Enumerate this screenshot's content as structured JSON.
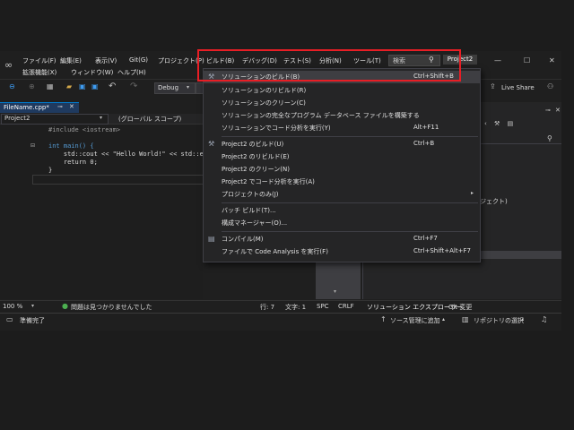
{
  "menubar": {
    "row1": [
      "ファイル(F)",
      "編集(E)",
      "表示(V)",
      "Git(G)",
      "プロジェクト(P)",
      "ビルド(B)",
      "デバッグ(D)",
      "テスト(S)",
      "分析(N)",
      "ツール(T)"
    ],
    "row2": [
      "拡張機能(X)",
      "ウィンドウ(W)",
      "ヘルプ(H)"
    ],
    "search_label": "検索",
    "project_badge": "Project2"
  },
  "window_controls": {
    "minimize": "—",
    "maximize": "☐",
    "close": "✕"
  },
  "toolbar": {
    "config": "Debug",
    "live_share": "Live Share"
  },
  "editor": {
    "tab": "FileName.cpp*",
    "project_combo": "Project2",
    "scope_combo": "(グローバル スコープ)",
    "lines": [
      "#include <iostream>",
      "",
      "int main() {",
      "    std::cout << \"Hello World!\" << std::endl;",
      "    return 0;",
      "}"
    ],
    "zoom": "100 %",
    "issues": "問題は見つかりませんでした",
    "position": "行: 7",
    "char": "文字: 1",
    "spc": "SPC",
    "crlf": "CRLF"
  },
  "solution_panel": {
    "item": "ジェクト)",
    "tab_solution": "ソリューション エクスプローラー",
    "tab_git": "Git 変更"
  },
  "dropdown": {
    "items": [
      {
        "label": "ソリューションのビルド(B)",
        "shortcut": "Ctrl+Shift+B",
        "icon": "build-icon"
      },
      {
        "label": "ソリューションのリビルド(R)",
        "shortcut": ""
      },
      {
        "label": "ソリューションのクリーン(C)",
        "shortcut": ""
      },
      {
        "label": "ソリューションの完全なプログラム データベース ファイルを構築する",
        "shortcut": ""
      },
      {
        "label": "ソリューションでコード分析を実行(Y)",
        "shortcut": "Alt+F11"
      },
      {
        "label": "Project2 のビルド(U)",
        "shortcut": "Ctrl+B",
        "icon": "project-build-icon"
      },
      {
        "label": "Project2 のリビルド(E)",
        "shortcut": ""
      },
      {
        "label": "Project2 のクリーン(N)",
        "shortcut": ""
      },
      {
        "label": "Project2 でコード分析を実行(A)",
        "shortcut": ""
      },
      {
        "label": "プロジェクトのみ(J)",
        "shortcut": "",
        "submenu": "▸"
      },
      {
        "label": "バッチ ビルド(T)...",
        "shortcut": ""
      },
      {
        "label": "構成マネージャー(O)...",
        "shortcut": ""
      },
      {
        "label": "コンパイル(M)",
        "shortcut": "Ctrl+F7",
        "icon": "compile-icon"
      },
      {
        "label": "ファイルで Code Analysis を実行(F)",
        "shortcut": "Ctrl+Shift+Alt+F7"
      }
    ]
  },
  "statusbar": {
    "ready": "準備完了",
    "source_control": "ソース管理に追加",
    "repo_select": "リポジトリの選択"
  },
  "colors": {
    "accent": "#007acc",
    "highlight": "#e81e25",
    "menu_bg": "#252526",
    "editor_bg": "#1e1e1e"
  }
}
